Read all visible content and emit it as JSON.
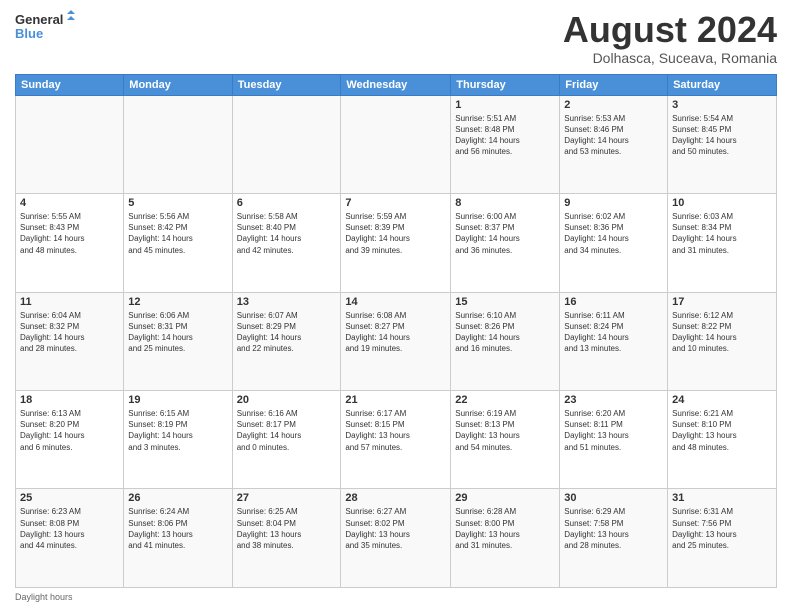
{
  "logo": {
    "line1": "General",
    "line2": "Blue"
  },
  "title": "August 2024",
  "subtitle": "Dolhasca, Suceava, Romania",
  "weekdays": [
    "Sunday",
    "Monday",
    "Tuesday",
    "Wednesday",
    "Thursday",
    "Friday",
    "Saturday"
  ],
  "weeks": [
    [
      {
        "day": "",
        "info": ""
      },
      {
        "day": "",
        "info": ""
      },
      {
        "day": "",
        "info": ""
      },
      {
        "day": "",
        "info": ""
      },
      {
        "day": "1",
        "info": "Sunrise: 5:51 AM\nSunset: 8:48 PM\nDaylight: 14 hours\nand 56 minutes."
      },
      {
        "day": "2",
        "info": "Sunrise: 5:53 AM\nSunset: 8:46 PM\nDaylight: 14 hours\nand 53 minutes."
      },
      {
        "day": "3",
        "info": "Sunrise: 5:54 AM\nSunset: 8:45 PM\nDaylight: 14 hours\nand 50 minutes."
      }
    ],
    [
      {
        "day": "4",
        "info": "Sunrise: 5:55 AM\nSunset: 8:43 PM\nDaylight: 14 hours\nand 48 minutes."
      },
      {
        "day": "5",
        "info": "Sunrise: 5:56 AM\nSunset: 8:42 PM\nDaylight: 14 hours\nand 45 minutes."
      },
      {
        "day": "6",
        "info": "Sunrise: 5:58 AM\nSunset: 8:40 PM\nDaylight: 14 hours\nand 42 minutes."
      },
      {
        "day": "7",
        "info": "Sunrise: 5:59 AM\nSunset: 8:39 PM\nDaylight: 14 hours\nand 39 minutes."
      },
      {
        "day": "8",
        "info": "Sunrise: 6:00 AM\nSunset: 8:37 PM\nDaylight: 14 hours\nand 36 minutes."
      },
      {
        "day": "9",
        "info": "Sunrise: 6:02 AM\nSunset: 8:36 PM\nDaylight: 14 hours\nand 34 minutes."
      },
      {
        "day": "10",
        "info": "Sunrise: 6:03 AM\nSunset: 8:34 PM\nDaylight: 14 hours\nand 31 minutes."
      }
    ],
    [
      {
        "day": "11",
        "info": "Sunrise: 6:04 AM\nSunset: 8:32 PM\nDaylight: 14 hours\nand 28 minutes."
      },
      {
        "day": "12",
        "info": "Sunrise: 6:06 AM\nSunset: 8:31 PM\nDaylight: 14 hours\nand 25 minutes."
      },
      {
        "day": "13",
        "info": "Sunrise: 6:07 AM\nSunset: 8:29 PM\nDaylight: 14 hours\nand 22 minutes."
      },
      {
        "day": "14",
        "info": "Sunrise: 6:08 AM\nSunset: 8:27 PM\nDaylight: 14 hours\nand 19 minutes."
      },
      {
        "day": "15",
        "info": "Sunrise: 6:10 AM\nSunset: 8:26 PM\nDaylight: 14 hours\nand 16 minutes."
      },
      {
        "day": "16",
        "info": "Sunrise: 6:11 AM\nSunset: 8:24 PM\nDaylight: 14 hours\nand 13 minutes."
      },
      {
        "day": "17",
        "info": "Sunrise: 6:12 AM\nSunset: 8:22 PM\nDaylight: 14 hours\nand 10 minutes."
      }
    ],
    [
      {
        "day": "18",
        "info": "Sunrise: 6:13 AM\nSunset: 8:20 PM\nDaylight: 14 hours\nand 6 minutes."
      },
      {
        "day": "19",
        "info": "Sunrise: 6:15 AM\nSunset: 8:19 PM\nDaylight: 14 hours\nand 3 minutes."
      },
      {
        "day": "20",
        "info": "Sunrise: 6:16 AM\nSunset: 8:17 PM\nDaylight: 14 hours\nand 0 minutes."
      },
      {
        "day": "21",
        "info": "Sunrise: 6:17 AM\nSunset: 8:15 PM\nDaylight: 13 hours\nand 57 minutes."
      },
      {
        "day": "22",
        "info": "Sunrise: 6:19 AM\nSunset: 8:13 PM\nDaylight: 13 hours\nand 54 minutes."
      },
      {
        "day": "23",
        "info": "Sunrise: 6:20 AM\nSunset: 8:11 PM\nDaylight: 13 hours\nand 51 minutes."
      },
      {
        "day": "24",
        "info": "Sunrise: 6:21 AM\nSunset: 8:10 PM\nDaylight: 13 hours\nand 48 minutes."
      }
    ],
    [
      {
        "day": "25",
        "info": "Sunrise: 6:23 AM\nSunset: 8:08 PM\nDaylight: 13 hours\nand 44 minutes."
      },
      {
        "day": "26",
        "info": "Sunrise: 6:24 AM\nSunset: 8:06 PM\nDaylight: 13 hours\nand 41 minutes."
      },
      {
        "day": "27",
        "info": "Sunrise: 6:25 AM\nSunset: 8:04 PM\nDaylight: 13 hours\nand 38 minutes."
      },
      {
        "day": "28",
        "info": "Sunrise: 6:27 AM\nSunset: 8:02 PM\nDaylight: 13 hours\nand 35 minutes."
      },
      {
        "day": "29",
        "info": "Sunrise: 6:28 AM\nSunset: 8:00 PM\nDaylight: 13 hours\nand 31 minutes."
      },
      {
        "day": "30",
        "info": "Sunrise: 6:29 AM\nSunset: 7:58 PM\nDaylight: 13 hours\nand 28 minutes."
      },
      {
        "day": "31",
        "info": "Sunrise: 6:31 AM\nSunset: 7:56 PM\nDaylight: 13 hours\nand 25 minutes."
      }
    ]
  ],
  "footer": "Daylight hours"
}
